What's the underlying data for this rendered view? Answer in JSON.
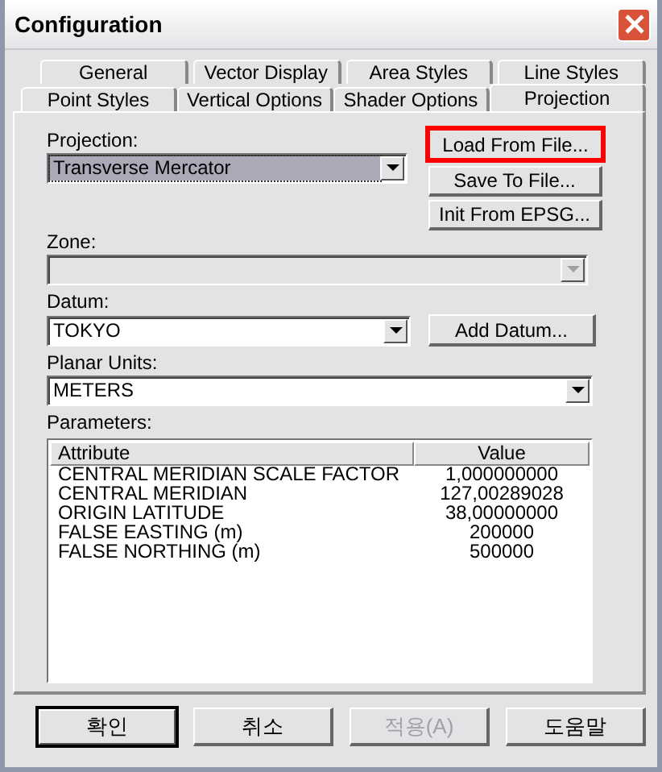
{
  "window": {
    "title": "Configuration"
  },
  "tab_rows": [
    [
      {
        "label": "General",
        "selected": false
      },
      {
        "label": "Vector Display",
        "selected": false
      },
      {
        "label": "Area Styles",
        "selected": false
      },
      {
        "label": "Line Styles",
        "selected": false
      }
    ],
    [
      {
        "label": "Point Styles",
        "selected": false
      },
      {
        "label": "Vertical Options",
        "selected": false
      },
      {
        "label": "Shader Options",
        "selected": false
      },
      {
        "label": "Projection",
        "selected": true
      }
    ]
  ],
  "projection": {
    "label": "Projection:",
    "value": "Transverse Mercator",
    "focused": true
  },
  "side_buttons": [
    {
      "label": "Load From File...",
      "highlighted": true
    },
    {
      "label": "Save To File...",
      "highlighted": false
    },
    {
      "label": "Init From EPSG...",
      "highlighted": false
    }
  ],
  "zone": {
    "label": "Zone:",
    "disabled": true
  },
  "datum": {
    "label": "Datum:",
    "value": "TOKYO",
    "button": "Add Datum..."
  },
  "planar_units": {
    "label": "Planar Units:",
    "value": "METERS"
  },
  "parameters": {
    "label": "Parameters:",
    "columns": [
      "Attribute",
      "Value"
    ],
    "rows": [
      [
        "CENTRAL MERIDIAN SCALE FACTOR",
        "1,000000000"
      ],
      [
        "CENTRAL MERIDIAN",
        "127,00289028"
      ],
      [
        "ORIGIN LATITUDE",
        "38,00000000"
      ],
      [
        "FALSE EASTING (m)",
        "200000"
      ],
      [
        "FALSE NORTHING (m)",
        "500000"
      ]
    ]
  },
  "buttons": [
    {
      "label": "확인",
      "default": true,
      "disabled": false
    },
    {
      "label": "취소",
      "default": false,
      "disabled": false
    },
    {
      "label": "적용(A)",
      "default": false,
      "disabled": true
    },
    {
      "label": "도움말",
      "default": false,
      "disabled": false
    }
  ]
}
